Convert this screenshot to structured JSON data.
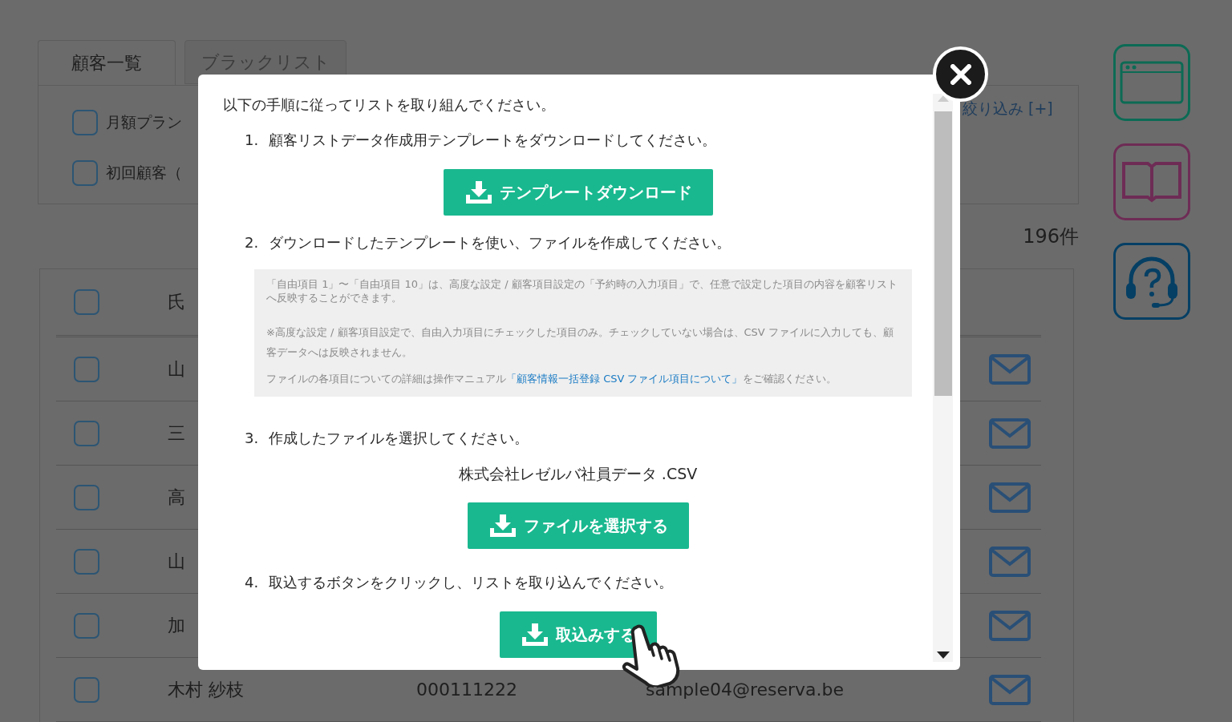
{
  "tabs": [
    {
      "label": "顧客一覧",
      "selected": true
    },
    {
      "label": "ブラックリスト",
      "selected": false
    }
  ],
  "filters": [
    {
      "label": "月額プラン",
      "checked": false
    },
    {
      "label": "初回顧客（",
      "checked": false
    }
  ],
  "filter_toggle": "絞り込み [+]",
  "count": "196件",
  "table": {
    "header": {
      "checked": false,
      "name": "氏"
    },
    "rows": [
      {
        "checked": false,
        "name": "山"
      },
      {
        "checked": false,
        "name": "三"
      },
      {
        "checked": false,
        "name": "高"
      },
      {
        "checked": false,
        "name": "山"
      },
      {
        "checked": false,
        "name": "加"
      },
      {
        "checked": false,
        "name": "木村 紗枝",
        "phone": "000111222",
        "email": "sample04@reserva.be"
      }
    ]
  },
  "modal": {
    "intro": "以下の手順に従ってリストを取り組んでください。",
    "steps": [
      {
        "number": "1.",
        "text": "顧客リストデータ作成用テンプレートをダウンロードしてください。",
        "button": "テンプレートダウンロード"
      },
      {
        "number": "2.",
        "text": "ダウンロードしたテンプレートを使い、ファイルを作成してください。",
        "notes": [
          {
            "text": "「自由項目 1」〜「自由項目 10」は、高度な設定 / 顧客項目設定の「予約時の入力項目」で、任意で設定した項目の内容を顧客リストへ反映することができます。"
          },
          {
            "text": "※高度な設定 / 顧客項目設定で、自由入力項目にチェックした項目のみ。チェックしていない場合は、CSV ファイルに入力しても、顧客データへは反映されません。"
          },
          {
            "text": "ファイルの各項目についての詳細は操作マニュアル",
            "link": "「顧客情報一括登録 CSV ファイル項目について」",
            "after": "をご確認ください。"
          }
        ]
      },
      {
        "number": "3.",
        "text": "作成したファイルを選択してください。",
        "file_name": "株式会社レゼルバ社員データ .CSV",
        "button": "ファイルを選択する"
      },
      {
        "number": "4.",
        "text": "取込するボタンをクリックし、リストを取り込んでください。",
        "button": "取込みする",
        "pointer": true
      }
    ]
  }
}
